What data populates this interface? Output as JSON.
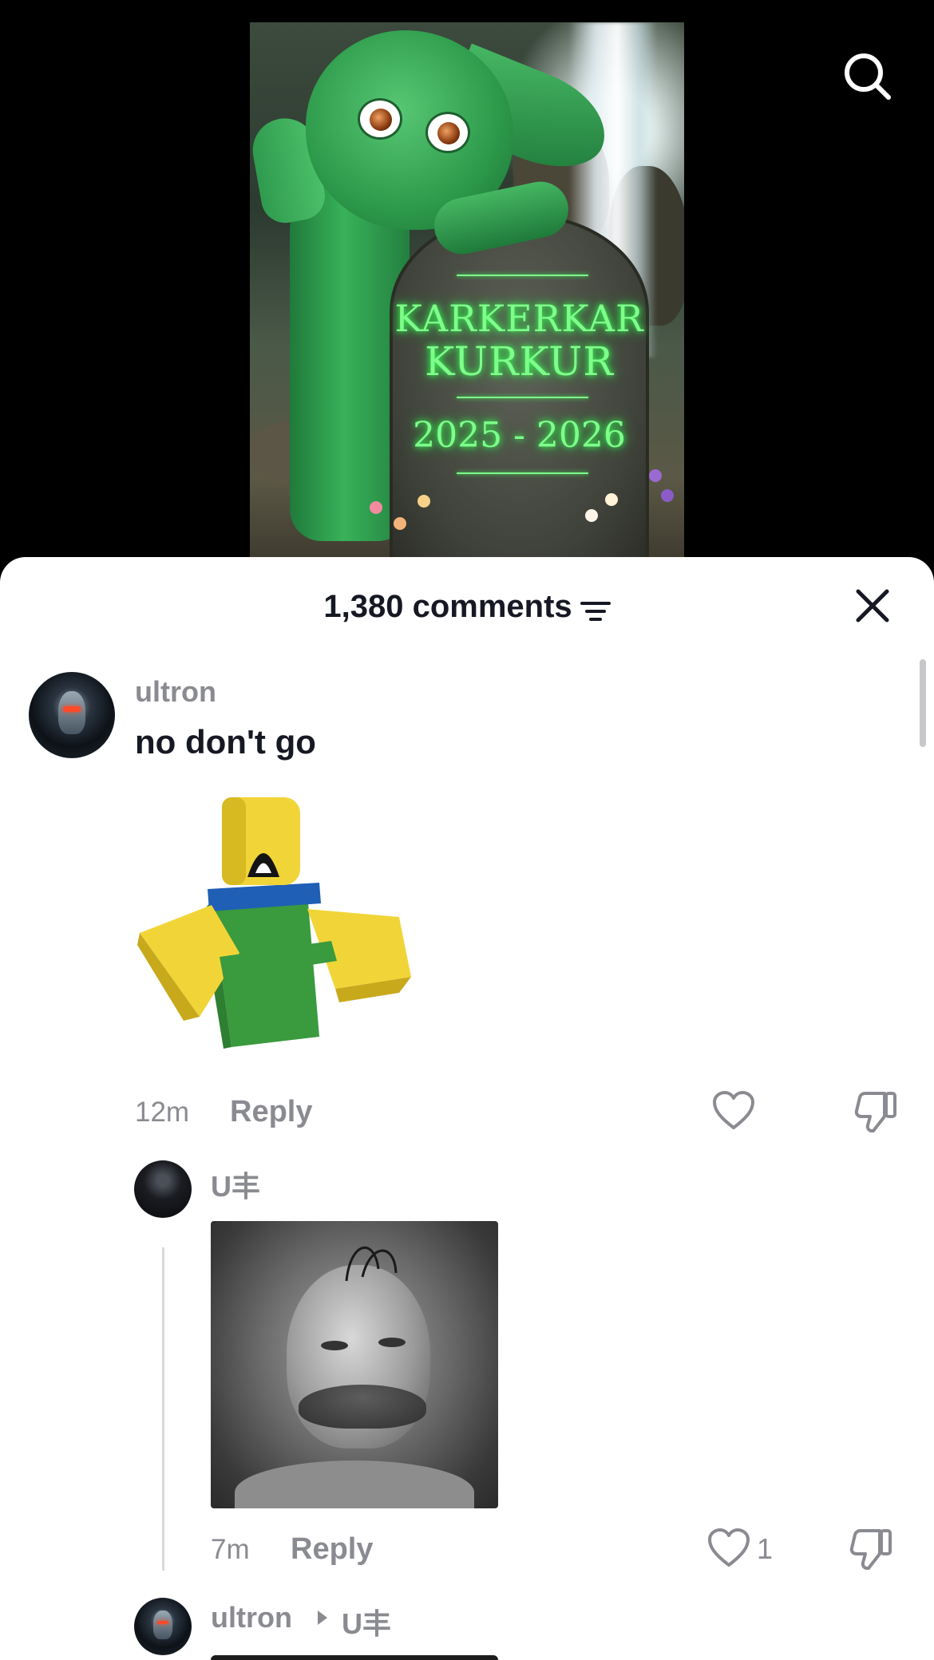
{
  "video": {
    "tombstone_line1": "KARKERKAR",
    "tombstone_line2": "KURKUR",
    "tombstone_years": "2025 - 2026"
  },
  "header": {
    "search_icon": "search-icon",
    "title": "1,380 comments",
    "filter_icon": "filter-icon",
    "close_icon": "close-icon"
  },
  "comments": [
    {
      "username": "ultron",
      "text": "no don't go",
      "time": "12m",
      "reply_label": "Reply",
      "like_icon": "heart-icon",
      "dislike_icon": "thumbs-down-icon"
    }
  ],
  "replies": [
    {
      "username": "U丰",
      "time": "7m",
      "reply_label": "Reply",
      "likes": "1",
      "like_icon": "heart-icon",
      "dislike_icon": "thumbs-down-icon"
    },
    {
      "username": "ultron",
      "reply_to": "U丰",
      "arrow_icon": "play-arrow-icon"
    }
  ],
  "colors": {
    "text_primary": "#161823",
    "text_secondary": "#8a8b91",
    "sheet_bg": "#ffffff",
    "video_bg": "#000000",
    "tombstone_glow": "#7dff8a"
  }
}
